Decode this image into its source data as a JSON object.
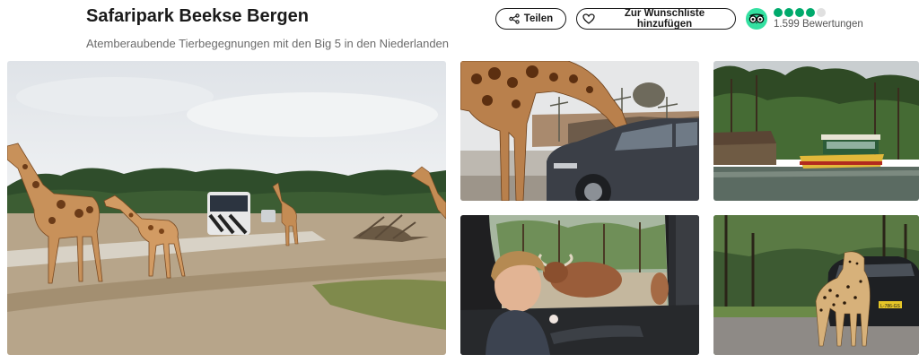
{
  "header": {
    "title": "Safaripark Beekse Bergen",
    "subtitle": "Atemberaubende Tierbegegnungen mit den Big 5 in den Niederlanden"
  },
  "actions": {
    "share_label": "Teilen",
    "share_icon": "share-icon",
    "wishlist_label": "Zur Wunschliste hinzufügen",
    "wishlist_icon": "heart-icon"
  },
  "rating": {
    "provider_icon": "tripadvisor-owl-icon",
    "bubbles_filled": 4,
    "bubbles_total": 5,
    "reviews_text": "1.599 Bewertungen",
    "color": "#00aa6c"
  },
  "gallery": {
    "photos": [
      {
        "subject": "giraffes-safari-bus"
      },
      {
        "subject": "giraffe-at-car"
      },
      {
        "subject": "safari-boat-lake"
      },
      {
        "subject": "child-in-car-window"
      },
      {
        "subject": "cheetah-in-front-of-car"
      }
    ],
    "plate_text": "L-786-GS"
  }
}
